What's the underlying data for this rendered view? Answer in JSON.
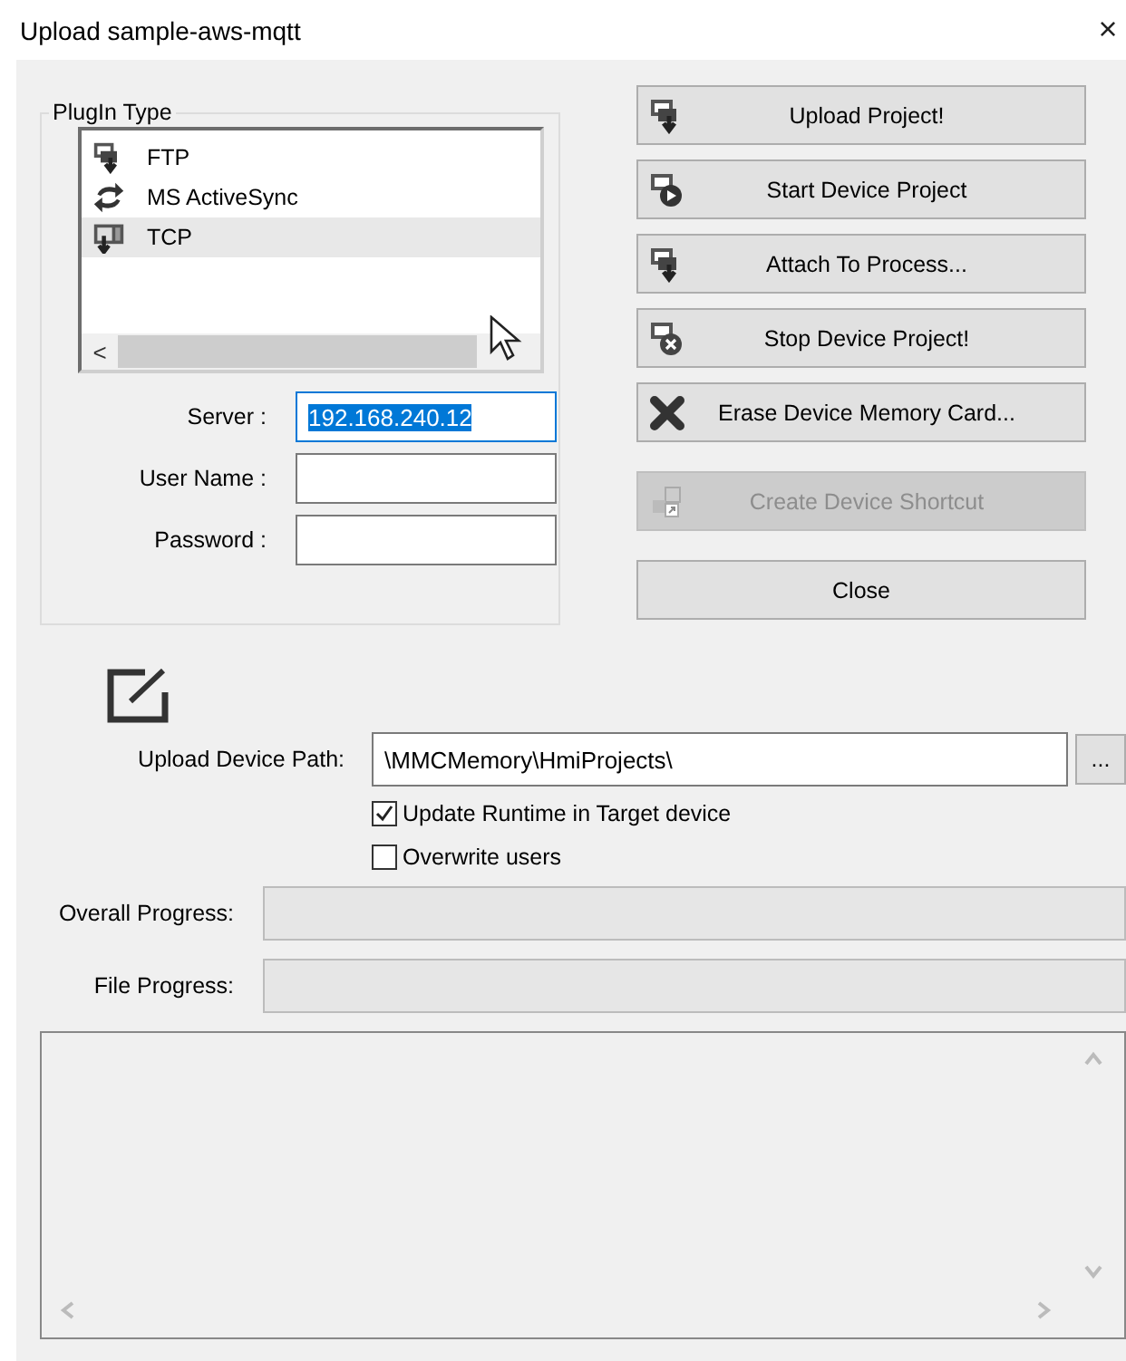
{
  "window": {
    "title": "Upload sample-aws-mqtt",
    "close": "×"
  },
  "plugin_group": {
    "label": "PlugIn Type",
    "items": [
      {
        "label": "FTP",
        "kind": "ftp",
        "selected": false
      },
      {
        "label": "MS ActiveSync",
        "kind": "sync",
        "selected": false
      },
      {
        "label": "TCP",
        "kind": "tcp",
        "selected": true
      }
    ],
    "scroll_left": "<"
  },
  "connection_fields": [
    {
      "label": "Server :",
      "value": "192.168.240.12",
      "focused": true,
      "text_selected": true
    },
    {
      "label": "User Name :",
      "focused": false
    },
    {
      "label": "Password :",
      "focused": false
    }
  ],
  "buttons": [
    {
      "label": "Upload Project!",
      "kind": "upload",
      "disabled": false
    },
    {
      "label": "Start Device Project",
      "kind": "start",
      "disabled": false
    },
    {
      "label": "Attach To Process...",
      "kind": "upload",
      "disabled": false
    },
    {
      "label": "Stop Device Project!",
      "kind": "stop",
      "disabled": false
    },
    {
      "label": "Erase Device Memory Card...",
      "kind": "erase",
      "disabled": false
    },
    {
      "label": "Create Device Shortcut",
      "kind": "shortcut",
      "disabled": true
    },
    {
      "label": "Close",
      "kind": "plain",
      "disabled": false
    }
  ],
  "path": {
    "label": "Upload Device Path:",
    "value": "\\MMCMemory\\HmiProjects\\",
    "browse": "..."
  },
  "checkboxes": [
    {
      "label": "Update Runtime in Target device",
      "checked": true
    },
    {
      "label": "Overwrite users",
      "checked": false
    }
  ],
  "progress": [
    {
      "label": "Overall Progress:",
      "level": 0
    },
    {
      "label": "File Progress:",
      "level": 0
    }
  ]
}
